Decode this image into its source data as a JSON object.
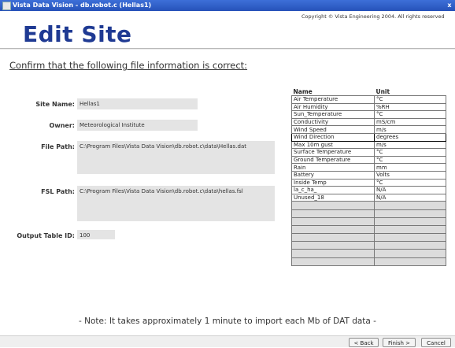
{
  "window": {
    "title": "Vista Data Vision - db.robot.c  (Hellas1)",
    "close_glyph": "x"
  },
  "header": {
    "title": "Edit Site",
    "copyright": "Copyright © Vista Engineering 2004.  All rights reserved"
  },
  "instruction": "Confirm that the following file information is correct:",
  "fields": {
    "site_name_label": "Site Name:",
    "site_name_value": "Hellas1",
    "owner_label": "Owner:",
    "owner_value": "Meteorological Institute",
    "file_path_label": "File Path:",
    "file_path_value": "C:\\Program Files\\Vista Data Vision\\db.robot.c\\data\\Hellas.dat",
    "fsl_path_label": "FSL Path:",
    "fsl_path_value": "C:\\Program Files\\Vista Data Vision\\db.robot.c\\data\\hellas.fsl",
    "output_table_label": "Output Table ID:",
    "output_table_value": "100"
  },
  "units_table": {
    "headers": [
      "Name",
      "Unit"
    ],
    "rows": [
      [
        "Air Temperature",
        "°C"
      ],
      [
        "Air Humidity",
        "%RH"
      ],
      [
        "Sun_Temperature",
        "°C"
      ],
      [
        "Conductivity",
        "mS/cm"
      ],
      [
        "Wind Speed",
        "m/s"
      ],
      [
        "Wind Direction",
        "degrees"
      ],
      [
        "Max 10m gust",
        "m/s"
      ],
      [
        "Surface Temperature",
        "°C"
      ],
      [
        "Ground Temperature",
        "°C"
      ],
      [
        "Rain",
        "mm"
      ],
      [
        "Battery",
        "Volts"
      ],
      [
        "Inside Temp",
        "°C"
      ],
      [
        "la_c_ha_",
        "N/A"
      ],
      [
        "Unused_18",
        "N/A"
      ]
    ],
    "empty_rows": 8
  },
  "note": "- Note:  It takes approximately 1 minute to import each Mb of DAT data -",
  "buttons": {
    "back": "< Back",
    "finish": "Finish >",
    "cancel": "Cancel"
  }
}
